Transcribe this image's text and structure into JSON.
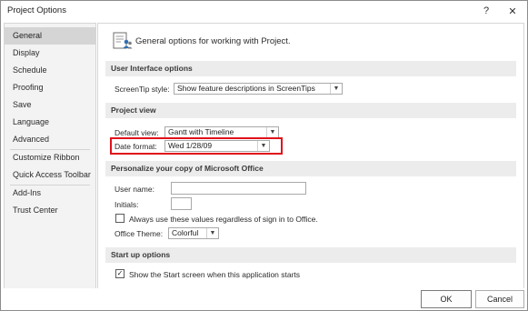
{
  "window": {
    "title": "Project Options",
    "help_glyph": "?",
    "close_glyph": "✕"
  },
  "sidebar": {
    "items": [
      {
        "label": "General"
      },
      {
        "label": "Display"
      },
      {
        "label": "Schedule"
      },
      {
        "label": "Proofing"
      },
      {
        "label": "Save"
      },
      {
        "label": "Language"
      },
      {
        "label": "Advanced"
      },
      {
        "label": "Customize Ribbon"
      },
      {
        "label": "Quick Access Toolbar"
      },
      {
        "label": "Add-Ins"
      },
      {
        "label": "Trust Center"
      }
    ],
    "selected": "General"
  },
  "main": {
    "heading": "General options for working with Project.",
    "ui_options": {
      "header": "User Interface options",
      "screentip_label": "ScreenTip style:",
      "screentip_value": "Show feature descriptions in ScreenTips"
    },
    "project_view": {
      "header": "Project view",
      "default_view_label": "Default view:",
      "default_view_value": "Gantt with Timeline",
      "date_format_label": "Date format:",
      "date_format_value": "Wed 1/28/09"
    },
    "personalize": {
      "header": "Personalize your copy of Microsoft Office",
      "user_name_label": "User name:",
      "user_name_value": "",
      "initials_label": "Initials:",
      "initials_value": "",
      "always_use_label": "Always use these values regardless of sign in to Office.",
      "always_use_checked": false,
      "office_theme_label": "Office Theme:",
      "office_theme_value": "Colorful"
    },
    "startup": {
      "header": "Start up options",
      "show_start_label": "Show the Start screen when this application starts",
      "show_start_checked": true,
      "check_glyph": "✓"
    }
  },
  "footer": {
    "ok_label": "OK",
    "cancel_label": "Cancel"
  },
  "colors": {
    "highlight_border": "#e0121b",
    "selected_nav_bg": "#d5d5d5",
    "section_header_bg": "#ececec"
  },
  "icons": {
    "options_icon": "settings-people-icon",
    "dropdown": "chevron-down-icon"
  }
}
